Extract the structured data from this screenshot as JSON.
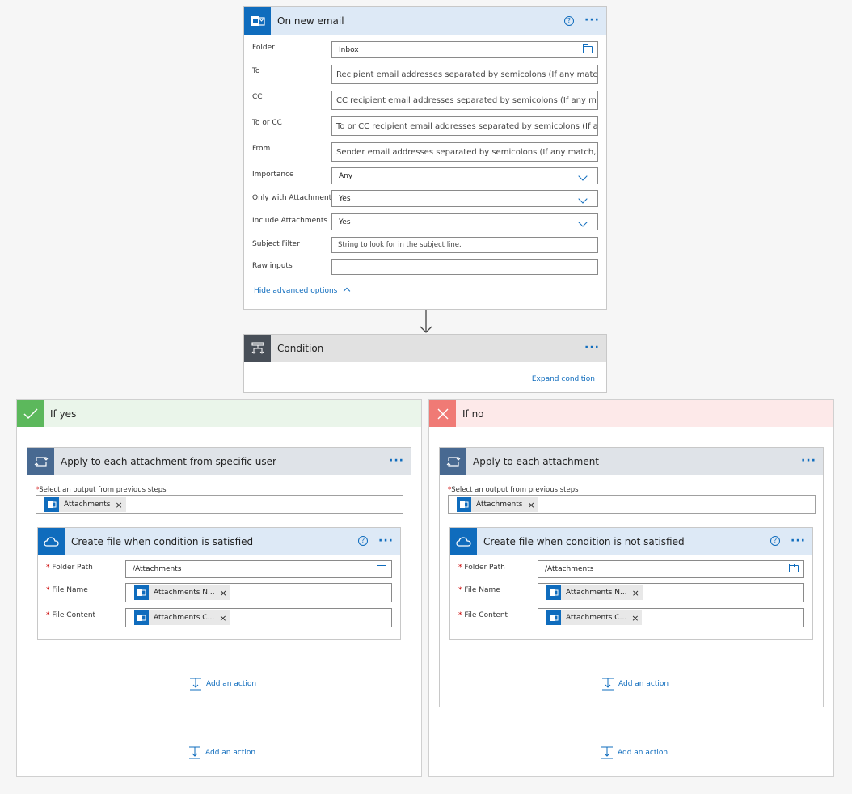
{
  "trigger": {
    "title": "On new email",
    "fields": {
      "folder": {
        "label": "Folder",
        "value": "Inbox"
      },
      "to": {
        "label": "To",
        "placeholder": "Recipient email addresses separated by semicolons (If any match,"
      },
      "cc": {
        "label": "CC",
        "placeholder": "CC recipient email addresses separated by semicolons (If any matc"
      },
      "to_or_cc": {
        "label": "To or CC",
        "placeholder": "To or CC recipient email addresses separated by semicolons (If any"
      },
      "from": {
        "label": "From",
        "placeholder": "Sender email addresses separated by semicolons (If any match, th"
      },
      "importance": {
        "label": "Importance",
        "value": "Any"
      },
      "only_attachments": {
        "label": "Only with Attachments",
        "value": "Yes"
      },
      "include_attachments": {
        "label": "Include Attachments",
        "value": "Yes"
      },
      "subject_filter": {
        "label": "Subject Filter",
        "placeholder": "String to look for in the subject line."
      },
      "raw_inputs": {
        "label": "Raw inputs",
        "value": ""
      }
    },
    "advanced_link": "Hide advanced options"
  },
  "condition": {
    "title": "Condition",
    "expand_link": "Expand condition"
  },
  "yes_branch": {
    "title": "If yes",
    "loop": {
      "title": "Apply to each attachment from specific user",
      "select_label": "Select an output from previous steps",
      "token": "Attachments",
      "action": {
        "title": "Create file when condition is satisfied",
        "folder_path": {
          "label": "Folder Path",
          "value": "/Attachments"
        },
        "file_name": {
          "label": "File Name",
          "token": "Attachments N..."
        },
        "file_content": {
          "label": "File Content",
          "token": "Attachments C..."
        }
      },
      "add_action": "Add an action"
    },
    "add_action": "Add an action"
  },
  "no_branch": {
    "title": "If no",
    "loop": {
      "title": "Apply to each attachment",
      "select_label": "Select an output from previous steps",
      "token": "Attachments",
      "action": {
        "title": "Create file when condition is not satisfied",
        "folder_path": {
          "label": "Folder Path",
          "value": "/Attachments"
        },
        "file_name": {
          "label": "File Name",
          "token": "Attachments N..."
        },
        "file_content": {
          "label": "File Content",
          "token": "Attachments C..."
        }
      },
      "add_action": "Add an action"
    },
    "add_action": "Add an action"
  },
  "colors": {
    "outlook_blue": "#0f6cbd",
    "condition_dark": "#484f58",
    "loop_blue": "#486991",
    "yes_green": "#5cb85c",
    "no_red": "#e57373"
  }
}
